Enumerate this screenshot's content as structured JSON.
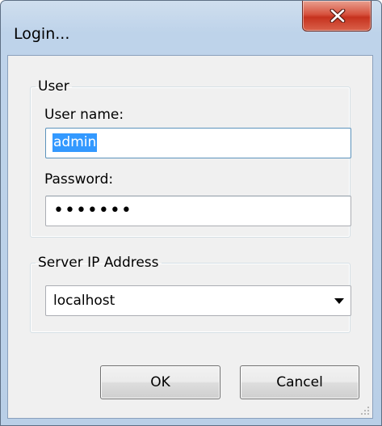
{
  "window": {
    "title": "Login...",
    "close_icon": "close-x-icon"
  },
  "user_group": {
    "legend": "User",
    "username_label": "User name:",
    "username_value": "admin",
    "password_label": "Password:",
    "password_mask": "•••••••"
  },
  "server_group": {
    "legend": "Server IP Address",
    "selected_value": "localhost",
    "dropdown_icon": "chevron-down-icon"
  },
  "buttons": {
    "ok_label": "OK",
    "cancel_label": "Cancel"
  },
  "colors": {
    "title_bar": "#bed3ea",
    "close_button": "#c6321e",
    "selection": "#3399ff",
    "dialog_background": "#f0f0f0"
  }
}
